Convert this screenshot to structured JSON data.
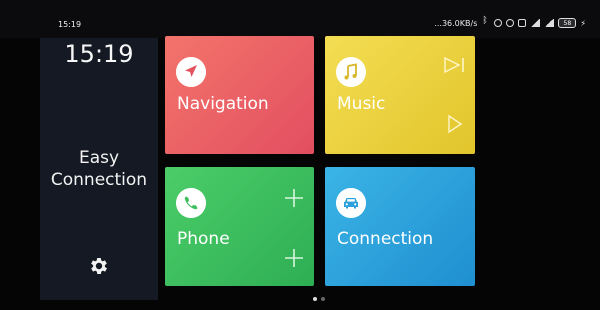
{
  "status_bar": {
    "time": "15:19",
    "network_speed": "...36.0KB/s",
    "battery": "58"
  },
  "sidebar": {
    "clock": "15:19",
    "app_name_line1": "Easy",
    "app_name_line2": "Connection"
  },
  "tiles": [
    {
      "label": "Navigation",
      "color": "#e95e66"
    },
    {
      "label": "Music",
      "color": "#ebd13e"
    },
    {
      "label": "Phone",
      "color": "#3cbe5d"
    },
    {
      "label": "Connection",
      "color": "#2aa1dc"
    }
  ],
  "pager": {
    "pages": 2,
    "current": 1
  }
}
